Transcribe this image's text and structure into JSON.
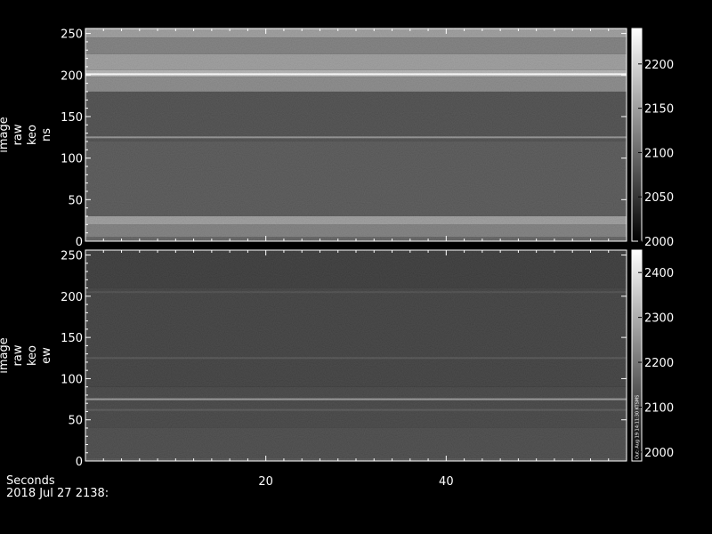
{
  "colors": {
    "background": "#000000",
    "axis": "#ffffff",
    "text": "#ffffff"
  },
  "footer": {
    "x_title": "Seconds",
    "date_label": "2018 Jul 27 2138:"
  },
  "chart_data": [
    {
      "type": "heatmap",
      "name": "ns",
      "ylabel": [
        "image",
        "raw",
        "keo",
        "ns"
      ],
      "xlim": [
        0,
        60
      ],
      "ylim": [
        0,
        256
      ],
      "x_ticks": [
        20,
        40
      ],
      "y_ticks": [
        0,
        50,
        100,
        150,
        200,
        250
      ],
      "colorbar": {
        "range": [
          2000,
          2240
        ],
        "ticks": [
          2000,
          2050,
          2100,
          2150,
          2200
        ],
        "colormap": "grayscale"
      },
      "bands": [
        {
          "y": [
            0,
            5
          ],
          "value": 2080
        },
        {
          "y": [
            5,
            20
          ],
          "value": 2110
        },
        {
          "y": [
            20,
            30
          ],
          "value": 2140
        },
        {
          "y": [
            30,
            120
          ],
          "value": 2070
        },
        {
          "y": [
            120,
            180
          ],
          "value": 2060
        },
        {
          "y": [
            180,
            198
          ],
          "value": 2120
        },
        {
          "y": [
            198,
            206
          ],
          "value": 2165
        },
        {
          "y": [
            206,
            225
          ],
          "value": 2140
        },
        {
          "y": [
            225,
            245
          ],
          "value": 2110
        },
        {
          "y": [
            245,
            256
          ],
          "value": 2140
        }
      ],
      "lines": [
        {
          "y": 125,
          "value": 2130
        },
        {
          "y": 201,
          "value": 2240
        }
      ]
    },
    {
      "type": "heatmap",
      "name": "ew",
      "ylabel": [
        "image",
        "raw",
        "keo",
        "ew"
      ],
      "xlim": [
        0,
        60
      ],
      "ylim": [
        0,
        256
      ],
      "x_ticks": [
        20,
        40
      ],
      "y_ticks": [
        0,
        50,
        100,
        150,
        200,
        250
      ],
      "colorbar": {
        "range": [
          1980,
          2450
        ],
        "ticks": [
          2000,
          2100,
          2200,
          2300,
          2400
        ],
        "colormap": "grayscale"
      },
      "bands": [
        {
          "y": [
            0,
            4
          ],
          "value": 2110
        },
        {
          "y": [
            4,
            40
          ],
          "value": 2090
        },
        {
          "y": [
            40,
            90
          ],
          "value": 2080
        },
        {
          "y": [
            90,
            210
          ],
          "value": 2070
        },
        {
          "y": [
            210,
            256
          ],
          "value": 2060
        }
      ],
      "lines": [
        {
          "y": 62,
          "value": 2120
        },
        {
          "y": 75,
          "value": 2250
        },
        {
          "y": 125,
          "value": 2110
        },
        {
          "y": 205,
          "value": 2100
        }
      ],
      "colorbar_annotation": "Out: Aug 19  14:11:30  KTSMS"
    }
  ]
}
